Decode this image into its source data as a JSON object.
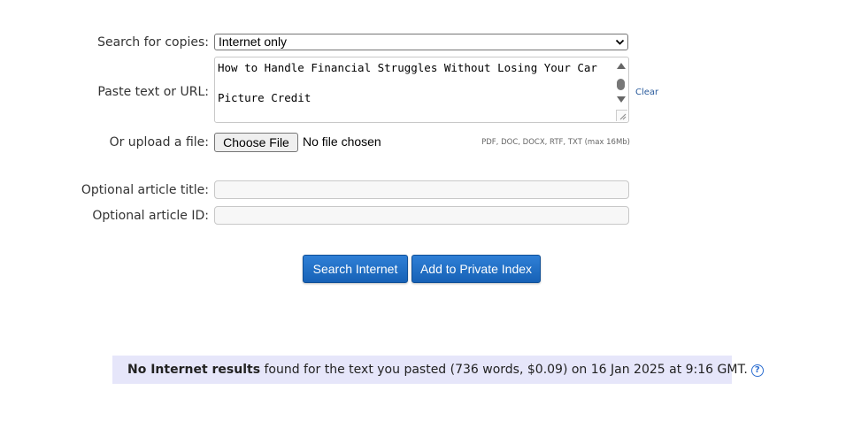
{
  "form": {
    "search_label": "Search for copies:",
    "search_select_value": "Internet only",
    "paste_label": "Paste text or URL:",
    "paste_text": "How to Handle Financial Struggles Without Losing Your Car\n\nPicture Credit",
    "clear_link": "Clear",
    "upload_label": "Or upload a file:",
    "choose_file_label": "Choose File",
    "file_status": "No file chosen",
    "file_hint": "PDF, DOC, DOCX, RTF, TXT (max 16Mb)",
    "title_label": "Optional article title:",
    "title_value": "",
    "id_label": "Optional article ID:",
    "id_value": ""
  },
  "actions": {
    "search_button": "Search Internet",
    "private_index_button": "Add to Private Index"
  },
  "result": {
    "bold_text": "No Internet results",
    "rest_text": " found for the text you pasted (736 words, $0.09) on 16 Jan 2025 at 9:16 GMT.",
    "help_icon": "?"
  },
  "icons": {
    "select": "chevron-down-icon",
    "help": "question-circle-icon"
  },
  "colors": {
    "button": "#1f6fc8",
    "result_bg": "#e6e6fa",
    "link": "#2a5b9c"
  }
}
